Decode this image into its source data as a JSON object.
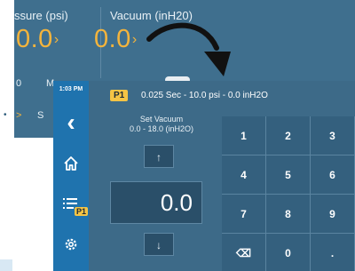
{
  "background_screen": {
    "pressure_label": "ssure (psi)",
    "pressure_value": "0.0",
    "vacuum_label": "Vacuum (inH20)",
    "vacuum_value": "0.0",
    "chevron": "›",
    "fragment_left": "0",
    "fragment_mid": "M",
    "fragment_bottom_left": ">",
    "fragment_bottom_mid": "S",
    "accent_color": "#f4b43c"
  },
  "sidebar": {
    "time": "1:03 PM",
    "items": [
      {
        "icon": "back-chevron-icon",
        "glyph": "‹"
      },
      {
        "icon": "home-icon"
      },
      {
        "icon": "list-icon",
        "badge": "P1"
      },
      {
        "icon": "gear-icon"
      }
    ]
  },
  "header": {
    "badge": "P1",
    "text": "0.025 Sec - 10.0 psi - 0.0 inH2O"
  },
  "setpoint": {
    "title": "Set Vacuum",
    "range": "0.0 - 18.0 (inH2O)",
    "value": "0.0",
    "up_glyph": "↑",
    "down_glyph": "↓"
  },
  "keypad": {
    "keys": [
      "1",
      "2",
      "3",
      "4",
      "5",
      "6",
      "7",
      "8",
      "9",
      "⌫",
      "0",
      "."
    ]
  },
  "colors": {
    "sidebar": "#1f73ae",
    "panel": "#3d6a88",
    "badge": "#f4c445"
  }
}
